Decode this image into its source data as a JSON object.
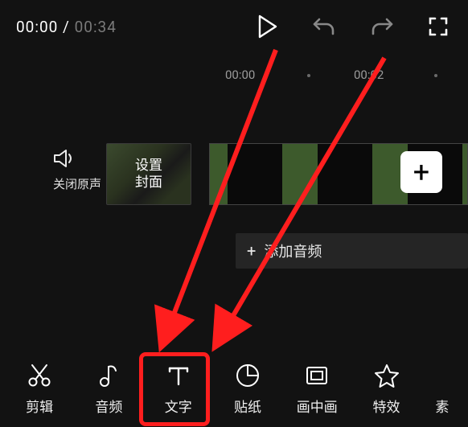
{
  "time": {
    "current": "00:00",
    "sep": " / ",
    "total": "00:34"
  },
  "ruler": {
    "t0": "00:00",
    "t1": "00:02"
  },
  "mute_label": "关闭原声",
  "cover_label": "设置\n封面",
  "add_clip_plus": "+",
  "add_audio": {
    "plus": "+",
    "label": "添加音频"
  },
  "tabs": {
    "edit": "剪辑",
    "audio": "音频",
    "text": "文字",
    "sticker": "贴纸",
    "pip": "画中画",
    "effect": "特效",
    "material": "素"
  }
}
